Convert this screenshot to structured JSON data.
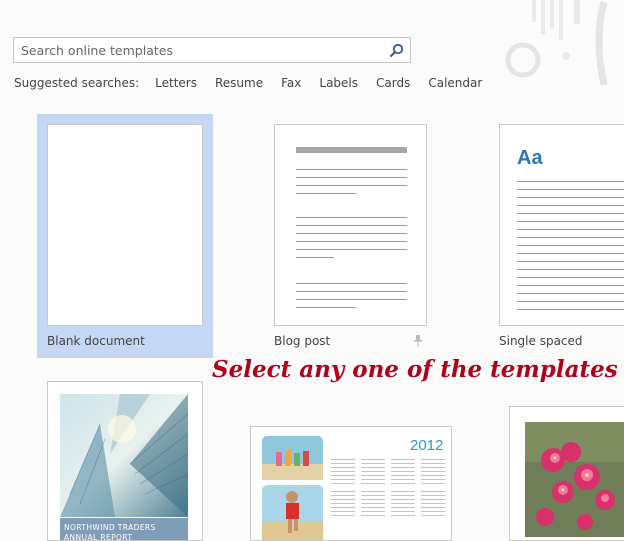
{
  "search": {
    "placeholder": "Search online templates"
  },
  "suggested": {
    "label": "Suggested searches:",
    "items": [
      "Letters",
      "Resume",
      "Fax",
      "Labels",
      "Cards",
      "Calendar"
    ]
  },
  "templates": [
    {
      "label": "Blank document",
      "selected": true
    },
    {
      "label": "Blog post",
      "pinnable": true
    },
    {
      "label": "Single spaced",
      "heading": "Aa"
    }
  ],
  "report_template": {
    "band_line1": "NORTHWIND TRADERS",
    "band_line2": "ANNUAL REPORT"
  },
  "calendar_template": {
    "year": "2012"
  },
  "annotation": "Select any one of the templates",
  "colors": {
    "selection": "#c5d7f2",
    "annotation": "#b0001a",
    "heading_blue": "#2e74b5",
    "calendar_year": "#2a9bb5"
  }
}
